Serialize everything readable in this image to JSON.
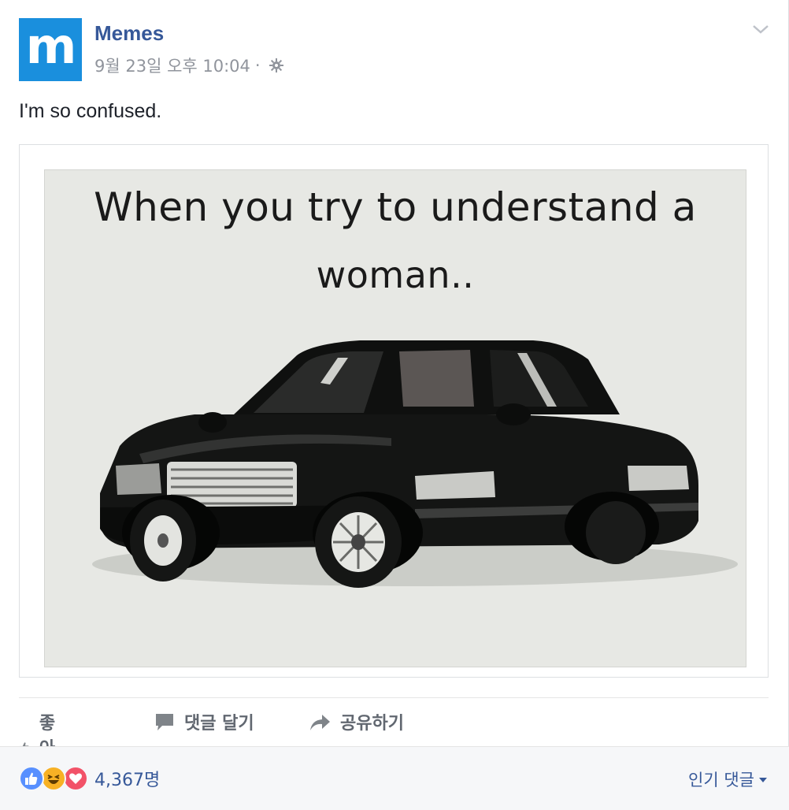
{
  "post": {
    "author": "Memes",
    "avatar_letter": "m",
    "timestamp": "9월 23일 오후 10:04",
    "separator": "·",
    "privacy_icon": "gear-icon",
    "menu_icon": "chevron-down-icon",
    "message": "I'm so confused.",
    "image": {
      "caption_line1": "When you try to understand a",
      "caption_line2": "woman.."
    }
  },
  "actions": {
    "like": "좋아요",
    "comment": "댓글 달기",
    "share": "공유하기"
  },
  "footer": {
    "reactions": [
      "like",
      "haha",
      "love"
    ],
    "reaction_count": "4,367명",
    "sort_label": "인기 댓글"
  },
  "colors": {
    "brand_blue": "#365899",
    "avatar_blue": "#1a8fdd",
    "meta_gray": "#90949c",
    "action_gray": "#616770"
  }
}
